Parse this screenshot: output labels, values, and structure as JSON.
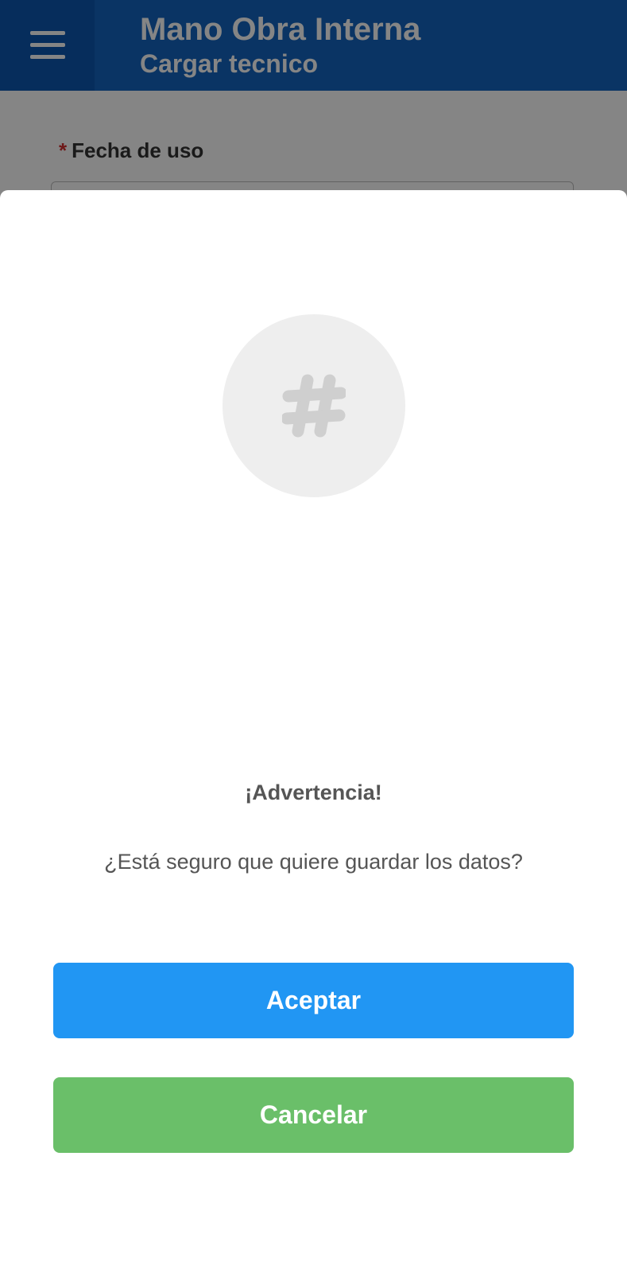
{
  "appbar": {
    "title": "Mano Obra Interna",
    "subtitle": "Cargar tecnico",
    "menu_icon": "hamburger-menu-icon",
    "color": "#1565c0"
  },
  "form": {
    "date_field": {
      "required_marker": "*",
      "label": "Fecha de uso",
      "value": ""
    }
  },
  "dialog": {
    "icon": "hash-icon",
    "title": "¡Advertencia!",
    "message": "¿Está seguro que quiere guardar los datos?",
    "accept_label": "Aceptar",
    "cancel_label": "Cancelar",
    "accept_color": "#2196f3",
    "cancel_color": "#6abf69"
  }
}
